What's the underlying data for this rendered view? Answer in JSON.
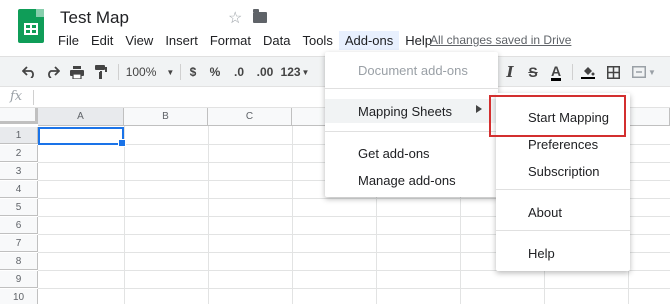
{
  "app": {
    "doc_title": "Test Map",
    "saved_status": "All changes saved in Drive"
  },
  "menubar": {
    "items": [
      "File",
      "Edit",
      "View",
      "Insert",
      "Format",
      "Data",
      "Tools",
      "Add-ons",
      "Help"
    ],
    "active": "Add-ons"
  },
  "toolbar": {
    "zoom": "100%",
    "currency": "$",
    "percent": "%",
    "dec_less": ".0",
    "dec_more": ".00",
    "more_formats": "123"
  },
  "formula_bar": {
    "fx_label": "fx"
  },
  "grid": {
    "columns": [
      "A",
      "B",
      "C"
    ],
    "rows": [
      "1",
      "2",
      "3",
      "4",
      "5",
      "6",
      "7",
      "8",
      "9",
      "10"
    ],
    "selected_cell": "A1"
  },
  "addons_menu": {
    "items": [
      {
        "label": "Document add-ons",
        "disabled": true
      },
      {
        "label": "Mapping Sheets",
        "has_submenu": true,
        "highlighted": true
      },
      {
        "label": "Get add-ons"
      },
      {
        "label": "Manage add-ons"
      }
    ]
  },
  "mapping_submenu": {
    "items": [
      "Start Mapping",
      "Preferences",
      "Subscription",
      "About",
      "Help"
    ],
    "highlighted": "Start Mapping"
  },
  "colors": {
    "sheets_green": "#0f9d58",
    "selection_blue": "#1a73e8",
    "highlight_red": "#d32f2f",
    "menu_highlight": "#f1f3f4"
  }
}
